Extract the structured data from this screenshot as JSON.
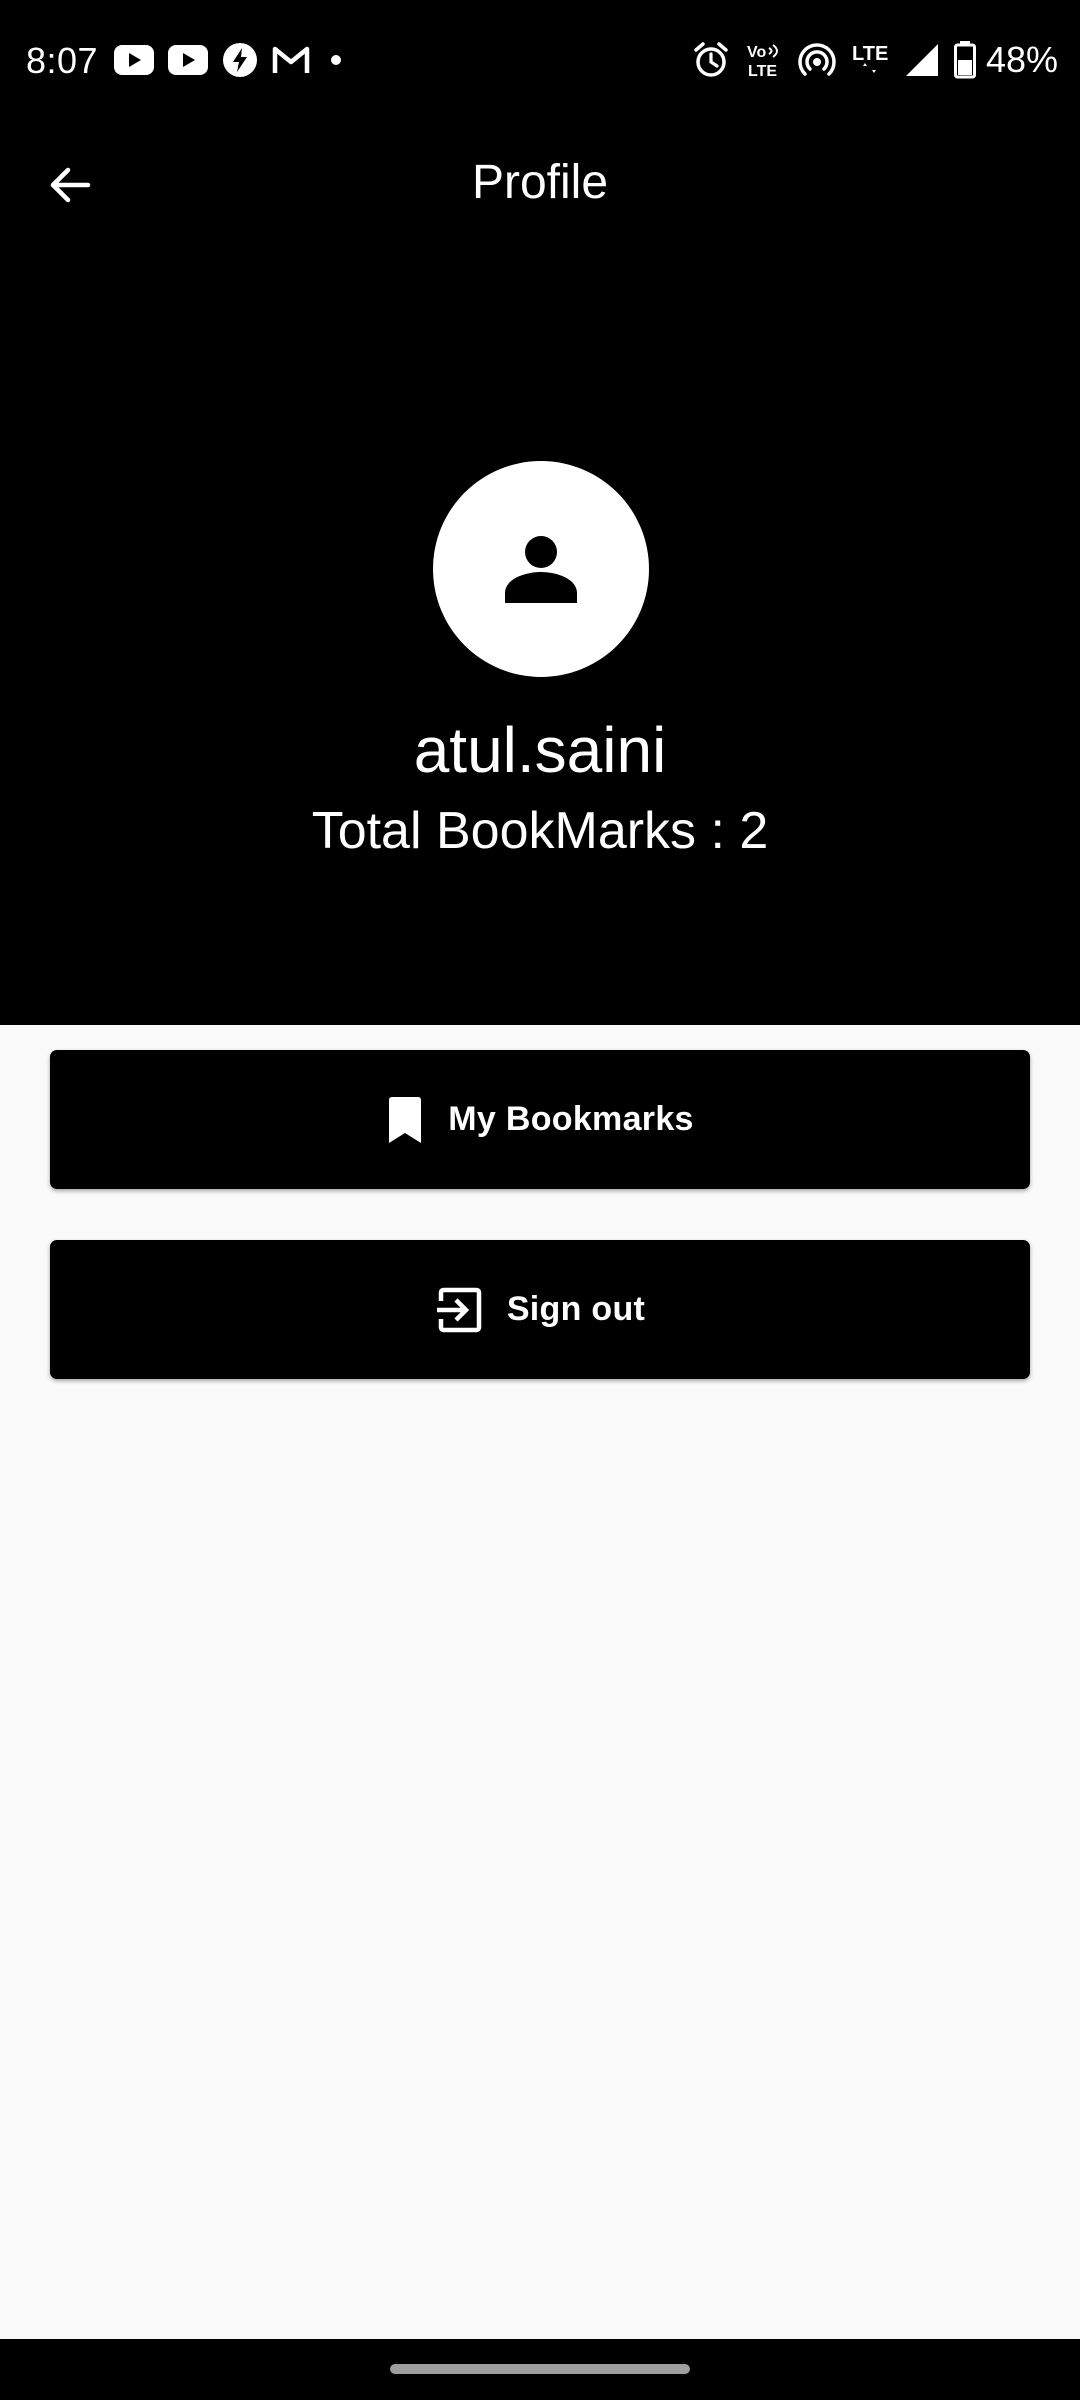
{
  "status_bar": {
    "time": "8:07",
    "notification_icons": [
      "youtube-icon",
      "youtube-icon",
      "bolt-icon",
      "gmail-icon",
      "dot-icon"
    ],
    "system_icons": [
      "alarm-icon",
      "volte-icon",
      "hotspot-icon",
      "lte-icon",
      "signal-icon",
      "battery-icon"
    ],
    "volte_text_top": "Vo",
    "volte_text_bottom": "LTE",
    "lte_text": "LTE",
    "battery_percent": "48%"
  },
  "header": {
    "back_icon": "arrow-back-icon",
    "title": "Profile"
  },
  "profile": {
    "avatar_icon": "person-icon",
    "username": "atul.saini",
    "bookmark_count_text": "Total BookMarks : 2"
  },
  "actions": {
    "bookmarks": {
      "icon": "bookmark-icon",
      "label": "My Bookmarks"
    },
    "signout": {
      "icon": "sign-out-icon",
      "label": "Sign out"
    }
  },
  "colors": {
    "header_bg": "#000000",
    "body_bg": "#fafafa",
    "button_bg": "#000000",
    "text_on_dark": "#ffffff"
  }
}
